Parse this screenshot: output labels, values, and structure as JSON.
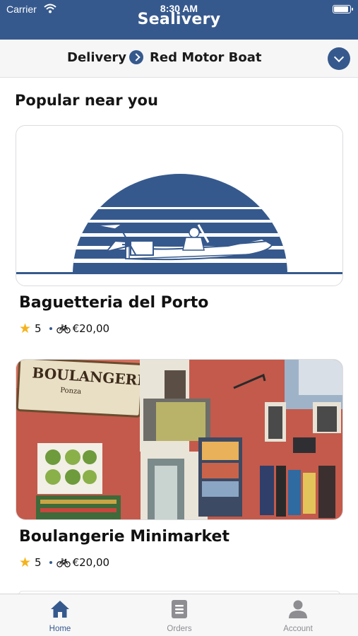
{
  "status_bar": {
    "carrier": "Carrier",
    "time": "8:30 AM"
  },
  "header": {
    "title": "Sealivery"
  },
  "delivery": {
    "mode": "Delivery",
    "boat": "Red Motor Boat"
  },
  "section": {
    "title": "Popular near you"
  },
  "restaurants": [
    {
      "name": "Baguetteria del Porto",
      "rating": "5",
      "delivery_fee": "€20,00",
      "image": "sealivery-boat-logo"
    },
    {
      "name": "Boulangerie Minimarket",
      "rating": "5",
      "delivery_fee": "€20,00",
      "image": "boulangerie-storefront-photo",
      "sign_text": "BOULANGERIE",
      "sign_subtext": "Ponza"
    }
  ],
  "tabs": [
    {
      "label": "Home",
      "icon": "home-icon",
      "active": true
    },
    {
      "label": "Orders",
      "icon": "orders-icon",
      "active": false
    },
    {
      "label": "Account",
      "icon": "account-icon",
      "active": false
    }
  ],
  "colors": {
    "brand": "#36598d",
    "star": "#f6b21b",
    "inactive": "#8d8d92"
  }
}
